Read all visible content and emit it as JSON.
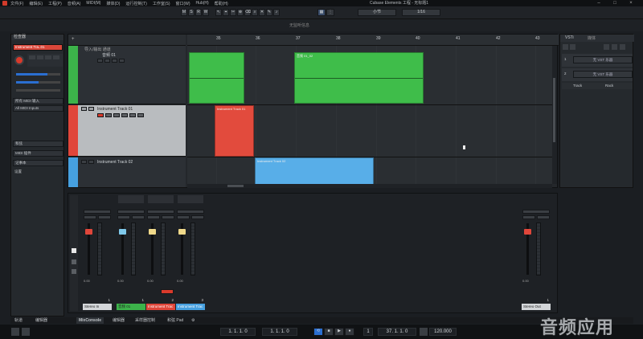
{
  "app": {
    "title": "Cubase Elements 工程 - 无标题1",
    "menus": [
      "文件(F)",
      "编辑(E)",
      "工程(P)",
      "音频(A)",
      "MIDI(M)",
      "媒体(D)",
      "运行控制(T)",
      "工作室(S)",
      "窗口(W)",
      "Hub(H)",
      "帮助(H)"
    ]
  },
  "toolbar": {
    "mode_buttons": [
      "M",
      "S",
      "R",
      "W"
    ],
    "snap_label": "小节",
    "quantize_label": "1/16",
    "status_text": "无监听信息"
  },
  "inspector": {
    "tab_label": "检查器",
    "track_name": "Instrument Tra..01",
    "rows": [
      "所有 MIDI 输入",
      "All MIDI Inputs"
    ],
    "sections": [
      "和弦",
      "MIDI 插件",
      "记事本",
      "设置"
    ]
  },
  "project": {
    "ruler": [
      "35",
      "36",
      "37",
      "38",
      "39",
      "40",
      "41",
      "42",
      "43"
    ],
    "tracks": [
      {
        "name": "音频 01",
        "header": "导入/输出 通道",
        "color": "#3cb34a"
      },
      {
        "name": "Instrument Track 01",
        "color": "#e0463a"
      },
      {
        "name": "Instrument Track 02",
        "color": "#46a0e0"
      }
    ],
    "parts": [
      {
        "label": "",
        "color": "#3fbd4a"
      },
      {
        "label": "音频 01_02",
        "color": "#3fbd4a"
      },
      {
        "label": "Instrument Track 01",
        "color": "#e24b3d"
      },
      {
        "label": "Instrument Track 02",
        "color": "#58aee8"
      }
    ]
  },
  "rack": {
    "tabs": [
      "VSTi",
      "媒体"
    ],
    "slots": [
      {
        "num": "1",
        "label": "无 VST 乐器"
      },
      {
        "num": "2",
        "label": "无 VST 乐器"
      }
    ],
    "footer": [
      "Track",
      "Rack"
    ]
  },
  "mixer": {
    "strips": [
      {
        "name": "Stereo In",
        "num": "1",
        "value": "0.00",
        "color": "#d3d6d9"
      },
      {
        "name": "音频 01",
        "num": "1",
        "value": "0.00",
        "color": "#3cb34a"
      },
      {
        "name": "Instrument Trac",
        "num": "2",
        "value": "0.00",
        "color": "#e0463a"
      },
      {
        "name": "Instrument Trac",
        "num": "3",
        "value": "0.00",
        "color": "#46a0e0"
      },
      {
        "name": "Stereo Out",
        "num": "1",
        "value": "0.00",
        "color": "#d3d6d9"
      }
    ]
  },
  "bottom_tabs": [
    "轨道",
    "编辑器",
    "MixConsole",
    "编辑器",
    "采样器控制",
    "和弦 Pad"
  ],
  "transport": {
    "position_left": "1. 1. 1. 0",
    "position_right": "1. 1. 1. 0",
    "time_sig": "1",
    "bar_position": "37. 1. 1. 0",
    "tempo": "120.000"
  },
  "watermark": "音频应用"
}
